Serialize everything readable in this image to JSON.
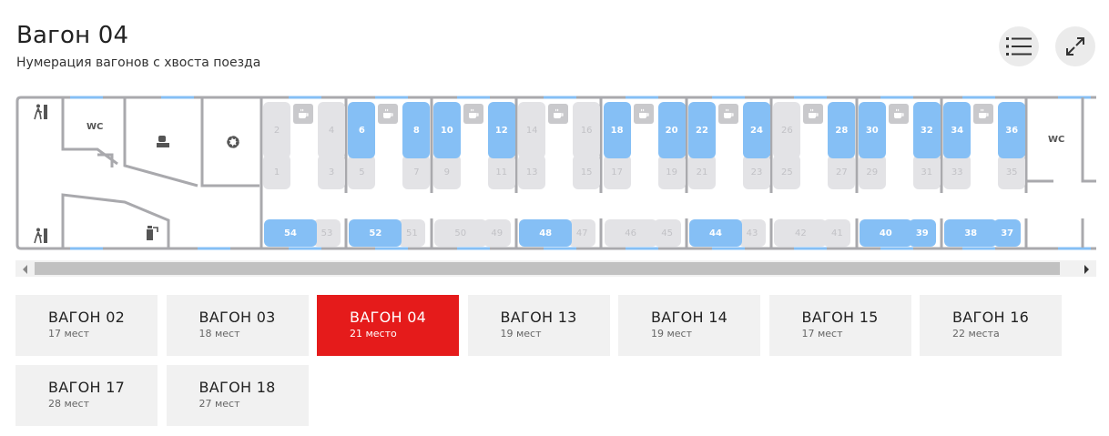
{
  "header": {
    "title": "Вагон 04",
    "subtitle": "Нумерация вагонов с хвоста поезда"
  },
  "toolbar": {
    "list_icon": "list-icon",
    "expand_icon": "expand-icon"
  },
  "scheme": {
    "wc_left": "WC",
    "wc_right": "WC",
    "icons": [
      "exit-icon",
      "staff-icon",
      "gear-icon",
      "fire-extinguisher-icon",
      "coffee-icon"
    ],
    "compartments": [
      {
        "top": "2",
        "bottom": "1",
        "top_free": false,
        "bottom_free": false
      },
      {
        "top": "4",
        "bottom": "3",
        "top_free": false,
        "bottom_free": false
      },
      {
        "top": "6",
        "bottom": "5",
        "top_free": true,
        "bottom_free": false
      },
      {
        "top": "8",
        "bottom": "7",
        "top_free": true,
        "bottom_free": false
      },
      {
        "top": "10",
        "bottom": "9",
        "top_free": true,
        "bottom_free": false
      },
      {
        "top": "12",
        "bottom": "11",
        "top_free": true,
        "bottom_free": false
      },
      {
        "top": "14",
        "bottom": "13",
        "top_free": false,
        "bottom_free": false
      },
      {
        "top": "16",
        "bottom": "15",
        "top_free": false,
        "bottom_free": false
      },
      {
        "top": "18",
        "bottom": "17",
        "top_free": true,
        "bottom_free": false
      },
      {
        "top": "20",
        "bottom": "19",
        "top_free": true,
        "bottom_free": false
      },
      {
        "top": "22",
        "bottom": "21",
        "top_free": true,
        "bottom_free": false
      },
      {
        "top": "24",
        "bottom": "23",
        "top_free": true,
        "bottom_free": false
      },
      {
        "top": "26",
        "bottom": "25",
        "top_free": false,
        "bottom_free": false
      },
      {
        "top": "28",
        "bottom": "27",
        "top_free": true,
        "bottom_free": false
      },
      {
        "top": "30",
        "bottom": "29",
        "top_free": true,
        "bottom_free": false
      },
      {
        "top": "32",
        "bottom": "31",
        "top_free": true,
        "bottom_free": false
      },
      {
        "top": "34",
        "bottom": "33",
        "top_free": true,
        "bottom_free": false
      },
      {
        "top": "36",
        "bottom": "35",
        "top_free": true,
        "bottom_free": false
      }
    ],
    "side_seats": [
      {
        "long": "54",
        "short": "53",
        "long_free": true,
        "short_free": false
      },
      {
        "long": "52",
        "short": "51",
        "long_free": true,
        "short_free": false
      },
      {
        "long": "50",
        "short": "49",
        "long_free": false,
        "short_free": false
      },
      {
        "long": "48",
        "short": "47",
        "long_free": true,
        "short_free": false
      },
      {
        "long": "46",
        "short": "45",
        "long_free": false,
        "short_free": false
      },
      {
        "long": "44",
        "short": "43",
        "long_free": true,
        "short_free": false
      },
      {
        "long": "42",
        "short": "41",
        "long_free": false,
        "short_free": false
      },
      {
        "long": "40",
        "short": "39",
        "long_free": true,
        "short_free": true
      },
      {
        "long": "38",
        "short": "37",
        "long_free": true,
        "short_free": true
      }
    ]
  },
  "cars": [
    {
      "name": "ВАГОН 02",
      "seats": "17 мест",
      "active": false
    },
    {
      "name": "ВАГОН 03",
      "seats": "18 мест",
      "active": false
    },
    {
      "name": "ВАГОН 04",
      "seats": "21 место",
      "active": true
    },
    {
      "name": "ВАГОН 13",
      "seats": "19 мест",
      "active": false
    },
    {
      "name": "ВАГОН 14",
      "seats": "19 мест",
      "active": false
    },
    {
      "name": "ВАГОН 15",
      "seats": "17 мест",
      "active": false
    },
    {
      "name": "ВАГОН 16",
      "seats": "22 места",
      "active": false
    },
    {
      "name": "ВАГОН 17",
      "seats": "28 мест",
      "active": false
    },
    {
      "name": "ВАГОН 18",
      "seats": "27 мест",
      "active": false
    }
  ]
}
